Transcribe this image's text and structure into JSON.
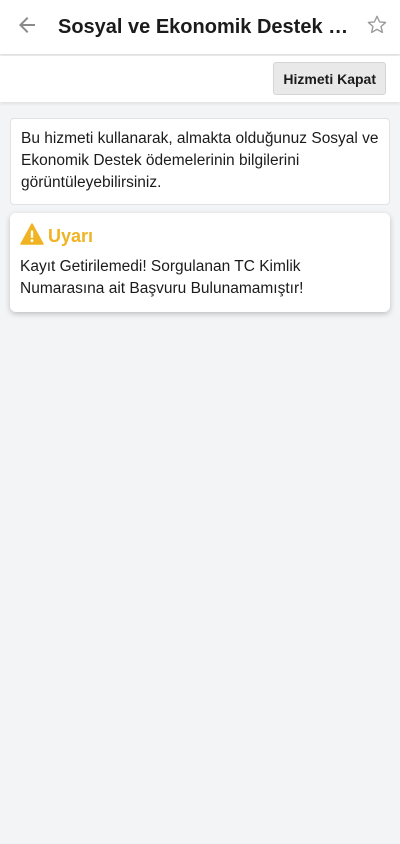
{
  "header": {
    "title": "Sosyal ve Ekonomik Destek Ödemeleri",
    "back_icon": "arrow-left-icon",
    "favorite_icon": "star-outline-icon"
  },
  "toolbar": {
    "close_service_label": "Hizmeti Kapat"
  },
  "info": {
    "text": "Bu hizmeti kullanarak, almakta olduğunuz Sosyal ve Ekonomik Destek ödemelerinin bilgilerini görüntüleyebilirsiniz."
  },
  "alert": {
    "title": "Uyarı",
    "icon": "warning-icon",
    "message": "Kayıt Getirilemedi! Sorgulanan TC Kimlik Numarasına ait Başvuru Bulunamamıştır!"
  },
  "colors": {
    "warning": "#f0b323",
    "background": "#f3f4f6",
    "icon_gray": "#8a8a8a"
  }
}
